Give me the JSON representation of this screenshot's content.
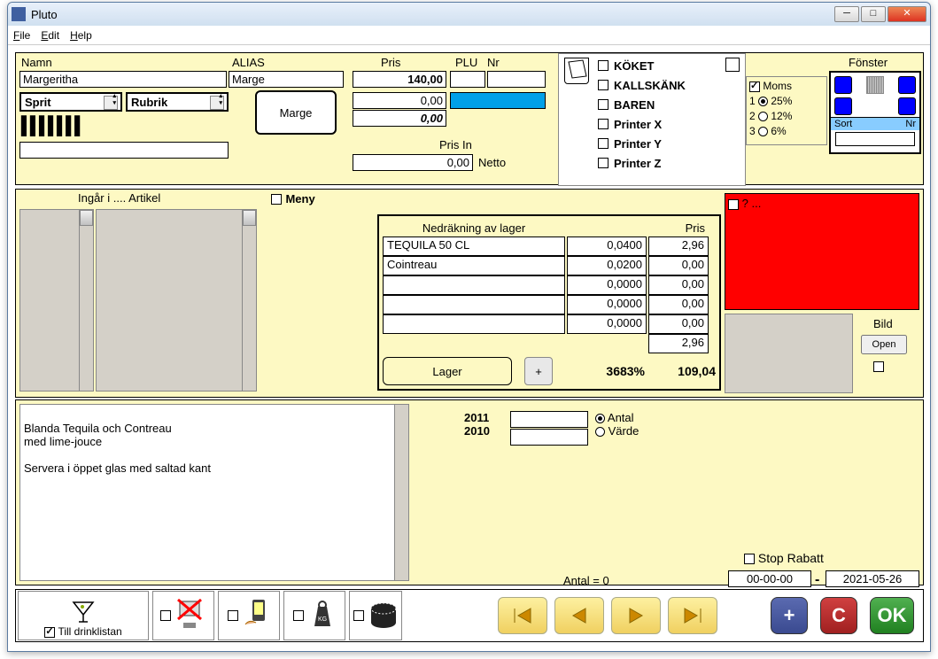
{
  "window": {
    "title": "Pluto"
  },
  "menu": {
    "file": "File",
    "edit": "Edit",
    "help": "Help"
  },
  "top": {
    "namn_lbl": "Namn",
    "alias_lbl": "ALIAS",
    "pris_lbl": "Pris",
    "plu_lbl": "PLU",
    "nr_lbl": "Nr",
    "namn": "Margeritha",
    "alias": "Marge",
    "pris1": "140,00",
    "pris2": "0,00",
    "pris3": "0,00",
    "dd1": "Sprit",
    "dd2": "Rubrik",
    "btn_marge": "Marge",
    "prisin_lbl": "Pris In",
    "prisin": "0,00",
    "netto": "Netto",
    "plu": "",
    "nr": ""
  },
  "printers": {
    "items": [
      "KÖKET",
      "KALLSKÄNK",
      "BAREN",
      "Printer X",
      "Printer Y",
      "Printer Z"
    ]
  },
  "fonster": {
    "title": "Fönster",
    "moms": "Moms",
    "r1": "25%",
    "r2": "12%",
    "r3": "6%",
    "sort": "Sort",
    "nr": "Nr"
  },
  "mid": {
    "ingar": "Ingår i .... Artikel",
    "meny": "Meny",
    "lager_hdr1": "Nedräkning av lager",
    "lager_hdr2": "Pris",
    "rows": [
      {
        "n": "TEQUILA 50 CL",
        "q": "0,0400",
        "p": "2,96"
      },
      {
        "n": "Cointreau",
        "q": "0,0200",
        "p": "0,00"
      },
      {
        "n": "",
        "q": "0,0000",
        "p": "0,00"
      },
      {
        "n": "",
        "q": "0,0000",
        "p": "0,00"
      },
      {
        "n": "",
        "q": "0,0000",
        "p": "0,00"
      }
    ],
    "total_p": "2,96",
    "lager_btn": "Lager",
    "plus": "+",
    "pct": "3683%",
    "sum": "109,04",
    "red_q": "? ...",
    "bild": "Bild",
    "open": "Open"
  },
  "bot": {
    "recipe": "Blanda Tequila och Contreau\nmed lime-jouce\n\nServera i öppet glas med saltad kant",
    "y1": "2011",
    "y2": "2010",
    "antal": "Antal",
    "varde": "Värde",
    "stop": "Stop Rabatt",
    "antal0": "Antal = 0",
    "date1": "00-00-00",
    "date2": "2021-05-26"
  },
  "toolbar": {
    "drink": "Till drinklistan",
    "plus": "+",
    "c": "C",
    "ok": "OK"
  }
}
